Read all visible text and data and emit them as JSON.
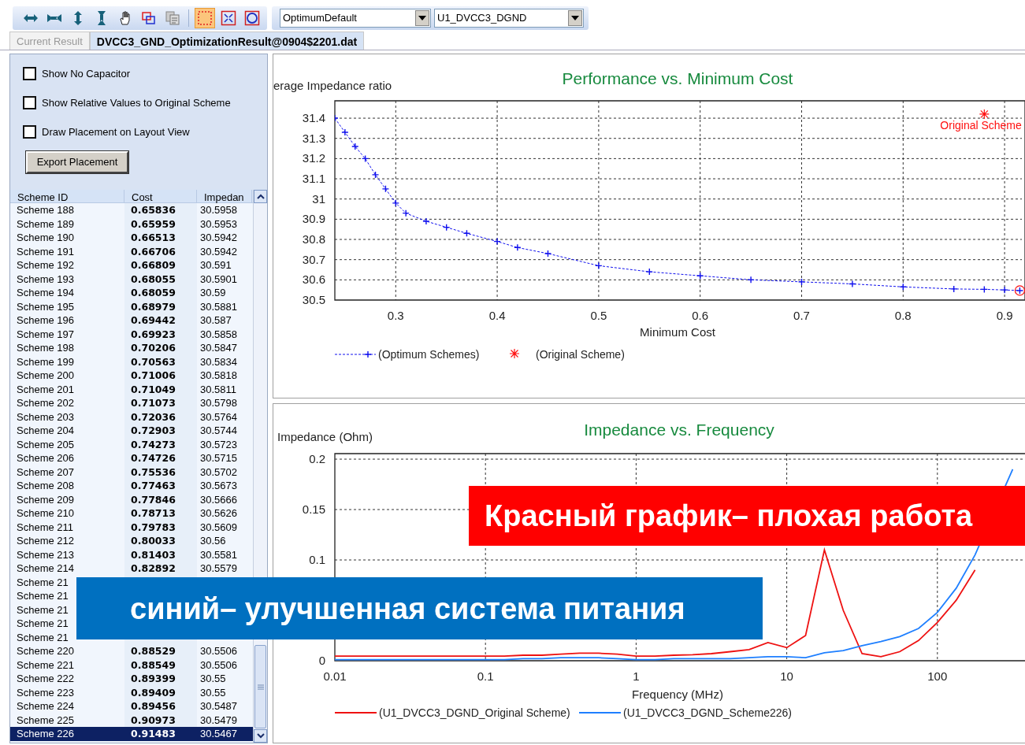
{
  "toolbar": {
    "buttons": [
      {
        "selected": false
      },
      {
        "selected": false
      },
      {
        "selected": false
      },
      {
        "selected": false
      },
      {
        "selected": false
      },
      {
        "selected": false
      },
      {
        "selected": false
      },
      {
        "selected": true
      },
      {
        "selected": false
      },
      {
        "selected": false
      }
    ]
  },
  "dropdowns": [
    {
      "value": "OptimumDefault"
    },
    {
      "value": "U1_DVCC3_DGND"
    }
  ],
  "tabs": [
    {
      "label": "Current Result",
      "selected": false
    },
    {
      "label": "DVCC3_GND_OptimizationResult@0904$2201.dat",
      "selected": true
    }
  ],
  "options": [
    {
      "label": "Show No Capacitor",
      "checked": false
    },
    {
      "label": "Show Relative Values to Original Scheme",
      "checked": false
    },
    {
      "label": "Draw Placement on Layout View",
      "checked": false
    }
  ],
  "export_button": "Export Placement",
  "table": {
    "columns": [
      "Scheme ID",
      "Cost",
      "Impedan"
    ],
    "rows": [
      {
        "id": "Scheme 188",
        "cost": "0.65836",
        "impedance": "30.5958",
        "selected": false
      },
      {
        "id": "Scheme 189",
        "cost": "0.65959",
        "impedance": "30.5953",
        "selected": false
      },
      {
        "id": "Scheme 190",
        "cost": "0.66513",
        "impedance": "30.5942",
        "selected": false
      },
      {
        "id": "Scheme 191",
        "cost": "0.66706",
        "impedance": "30.5942",
        "selected": false
      },
      {
        "id": "Scheme 192",
        "cost": "0.66809",
        "impedance": "30.591",
        "selected": false
      },
      {
        "id": "Scheme 193",
        "cost": "0.68055",
        "impedance": "30.5901",
        "selected": false
      },
      {
        "id": "Scheme 194",
        "cost": "0.68059",
        "impedance": "30.59",
        "selected": false
      },
      {
        "id": "Scheme 195",
        "cost": "0.68979",
        "impedance": "30.5881",
        "selected": false
      },
      {
        "id": "Scheme 196",
        "cost": "0.69442",
        "impedance": "30.587",
        "selected": false
      },
      {
        "id": "Scheme 197",
        "cost": "0.69923",
        "impedance": "30.5858",
        "selected": false
      },
      {
        "id": "Scheme 198",
        "cost": "0.70206",
        "impedance": "30.5847",
        "selected": false
      },
      {
        "id": "Scheme 199",
        "cost": "0.70563",
        "impedance": "30.5834",
        "selected": false
      },
      {
        "id": "Scheme 200",
        "cost": "0.71006",
        "impedance": "30.5818",
        "selected": false
      },
      {
        "id": "Scheme 201",
        "cost": "0.71049",
        "impedance": "30.5811",
        "selected": false
      },
      {
        "id": "Scheme 202",
        "cost": "0.71073",
        "impedance": "30.5798",
        "selected": false
      },
      {
        "id": "Scheme 203",
        "cost": "0.72036",
        "impedance": "30.5764",
        "selected": false
      },
      {
        "id": "Scheme 204",
        "cost": "0.72903",
        "impedance": "30.5744",
        "selected": false
      },
      {
        "id": "Scheme 205",
        "cost": "0.74273",
        "impedance": "30.5723",
        "selected": false
      },
      {
        "id": "Scheme 206",
        "cost": "0.74726",
        "impedance": "30.5715",
        "selected": false
      },
      {
        "id": "Scheme 207",
        "cost": "0.75536",
        "impedance": "30.5702",
        "selected": false
      },
      {
        "id": "Scheme 208",
        "cost": "0.77463",
        "impedance": "30.5673",
        "selected": false
      },
      {
        "id": "Scheme 209",
        "cost": "0.77846",
        "impedance": "30.5666",
        "selected": false
      },
      {
        "id": "Scheme 210",
        "cost": "0.78713",
        "impedance": "30.5626",
        "selected": false
      },
      {
        "id": "Scheme 211",
        "cost": "0.79783",
        "impedance": "30.5609",
        "selected": false
      },
      {
        "id": "Scheme 212",
        "cost": "0.80033",
        "impedance": "30.56",
        "selected": false
      },
      {
        "id": "Scheme 213",
        "cost": "0.81403",
        "impedance": "30.5581",
        "selected": false
      },
      {
        "id": "Scheme 214",
        "cost": "0.82892",
        "impedance": "30.5579",
        "selected": false
      },
      {
        "id": "Scheme 21",
        "selected": false
      },
      {
        "id": "Scheme 21",
        "selected": false
      },
      {
        "id": "Scheme 21",
        "selected": false
      },
      {
        "id": "Scheme 21",
        "selected": false
      },
      {
        "id": "Scheme 21",
        "selected": false
      },
      {
        "id": "Scheme 220",
        "cost": "0.88529",
        "impedance": "30.5506",
        "selected": false
      },
      {
        "id": "Scheme 221",
        "cost": "0.88549",
        "impedance": "30.5506",
        "selected": false
      },
      {
        "id": "Scheme 222",
        "cost": "0.89399",
        "impedance": "30.55",
        "selected": false
      },
      {
        "id": "Scheme 223",
        "cost": "0.89409",
        "impedance": "30.55",
        "selected": false
      },
      {
        "id": "Scheme 224",
        "cost": "0.89456",
        "impedance": "30.5487",
        "selected": false
      },
      {
        "id": "Scheme 225",
        "cost": "0.90973",
        "impedance": "30.5479",
        "selected": false
      },
      {
        "id": "Scheme 226",
        "cost": "0.91483",
        "impedance": "30.5467",
        "selected": true
      }
    ]
  },
  "charts": [
    {
      "chart_data": {
        "type": "line",
        "title": "Performance vs. Minimum Cost",
        "xlabel": "Minimum Cost",
        "ylabel": "erage Impedance ratio",
        "x": [
          0.24,
          0.25,
          0.26,
          0.27,
          0.28,
          0.29,
          0.3,
          0.31,
          0.33,
          0.35,
          0.37,
          0.4,
          0.42,
          0.45,
          0.5,
          0.55,
          0.6,
          0.65,
          0.7,
          0.75,
          0.8,
          0.85,
          0.88,
          0.9,
          0.915
        ],
        "series": [
          {
            "name": "(Optimum Schemes)",
            "color": "#1010ee",
            "line_style": "dashed",
            "marker": "plus",
            "values": [
              31.4,
              31.33,
              31.26,
              31.2,
              31.12,
              31.05,
              30.98,
              30.93,
              30.89,
              30.86,
              30.83,
              30.79,
              30.76,
              30.73,
              30.67,
              30.64,
              30.62,
              30.6,
              30.59,
              30.58,
              30.565,
              30.555,
              30.553,
              30.55,
              30.547
            ]
          },
          {
            "name": "(Original Scheme)",
            "color": "#ff1010",
            "marker": "cross",
            "values": [
              null,
              null,
              null,
              null,
              null,
              null,
              null,
              null,
              null,
              null,
              null,
              null,
              null,
              null,
              null,
              null,
              null,
              null,
              null,
              null,
              null,
              null,
              31.42,
              null,
              null
            ]
          }
        ],
        "grid": true,
        "legend": "bottom",
        "xlim": [
          0.24,
          0.917
        ],
        "ylim": [
          30.5,
          31.486
        ],
        "xticks": [
          0.3,
          0.4,
          0.5,
          0.6,
          0.7,
          0.8,
          0.9
        ],
        "yticks": [
          30.5,
          30.6,
          30.7,
          30.8,
          30.9,
          31,
          31.1,
          31.2,
          31.3,
          31.4
        ],
        "annotations": [
          {
            "text": "Original Scheme",
            "x": 0.88,
            "y": 31.42
          }
        ]
      }
    },
    {
      "chart_data": {
        "type": "line",
        "title": "Impedance vs. Frequency",
        "xlabel": "Frequency (MHz)",
        "ylabel": "Impedance (Ohm)",
        "categories": [
          "0.01",
          null,
          null,
          null,
          null,
          null,
          null,
          null,
          "0.1",
          null,
          null,
          null,
          null,
          null,
          null,
          null,
          "1",
          null,
          null,
          null,
          null,
          null,
          null,
          null,
          "10",
          null,
          null,
          null,
          null,
          null,
          null,
          null,
          "100",
          null,
          null,
          null,
          null
        ],
        "series": [
          {
            "name": "(U1_DVCC3_DGND_Original Scheme)",
            "color": "#ee1111",
            "line_style": "solid",
            "values": [
              0.0045,
              0.0045,
              0.0045,
              0.0045,
              0.0045,
              0.0045,
              0.0045,
              0.0045,
              0.0045,
              0.0045,
              0.0055,
              0.0055,
              0.0065,
              0.0075,
              0.0075,
              0.0065,
              0.0045,
              0.0045,
              0.0055,
              0.006,
              0.007,
              0.009,
              0.011,
              0.018,
              0.013,
              0.025,
              0.11,
              0.05,
              0.007,
              0.004,
              0.009,
              0.02,
              0.038,
              0.06,
              0.09,
              null,
              null
            ]
          },
          {
            "name": "(U1_DVCC3_DGND_Scheme226)",
            "color": "#1e7fff",
            "line_style": "solid",
            "values": [
              0.001,
              0.001,
              0.001,
              0.001,
              0.001,
              0.001,
              0.001,
              0.001,
              0.001,
              0.001,
              0.002,
              0.002,
              0.003,
              0.003,
              0.003,
              0.002,
              0.001,
              0.001,
              0.002,
              0.002,
              0.002,
              0.002,
              0.003,
              0.004,
              0.004,
              0.003,
              0.008,
              0.01,
              0.015,
              0.019,
              0.024,
              0.032,
              0.048,
              0.072,
              0.105,
              null,
              0.19
            ]
          }
        ],
        "grid": true,
        "legend": "bottom",
        "ylim": [
          0,
          0.2055
        ],
        "yticks": [
          0,
          0.1,
          0.15,
          0.2
        ]
      }
    }
  ],
  "banners": [
    {
      "text": "Красный график– плохая работа",
      "color": "#ff0000"
    },
    {
      "text": "синий– улучшенная система питания",
      "color": "#0070c0"
    }
  ]
}
